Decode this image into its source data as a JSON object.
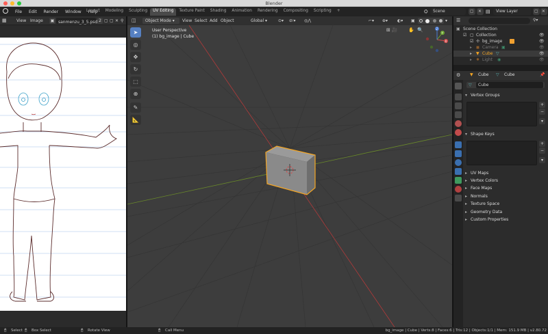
{
  "window": {
    "title": "Blender",
    "traffic_colors": [
      "#fd5f57",
      "#febc2e",
      "#28c840"
    ]
  },
  "topbar": {
    "menus": [
      "File",
      "Edit",
      "Render",
      "Window",
      "Help"
    ],
    "workspaces": [
      "Layout",
      "Modeling",
      "Sculpting",
      "UV Editing",
      "Texture Paint",
      "Shading",
      "Animation",
      "Rendering",
      "Compositing",
      "Scripting"
    ],
    "active_workspace": "UV Editing",
    "add_tab": "+",
    "scene": "Scene",
    "view_layer": "View Layer"
  },
  "image_editor": {
    "menus": [
      "View",
      "Image"
    ],
    "image_name": "sanmenzu_3_5.psd",
    "users": "2"
  },
  "viewport": {
    "mode": "Object Mode",
    "menus": [
      "View",
      "Select",
      "Add",
      "Object"
    ],
    "orientation": "Global",
    "info_line1": "User Perspective",
    "info_line2": "(1) bg_image | Cube",
    "gizmo": {
      "x": "X",
      "y": "Y",
      "z": "Z"
    },
    "colors": {
      "cube_outline": "#f5a623",
      "x_axis": "#b33a3a",
      "y_axis": "#6a8a2a"
    }
  },
  "outliner": {
    "title": "Scene Collection",
    "items": [
      {
        "label": "Collection"
      },
      {
        "label": "bg_image"
      },
      {
        "label": "Camera"
      },
      {
        "label": "Cube"
      },
      {
        "label": "Light"
      }
    ]
  },
  "properties": {
    "breadcrumb_obj": "Cube",
    "breadcrumb_data": "Cube",
    "data_name": "Cube",
    "panels": {
      "vertex_groups": "Vertex Groups",
      "shape_keys": "Shape Keys",
      "uv_maps": "UV Maps",
      "vertex_colors": "Vertex Colors",
      "face_maps": "Face Maps",
      "normals": "Normals",
      "texture_space": "Texture Space",
      "geometry_data": "Geometry Data",
      "custom_properties": "Custom Properties"
    },
    "plus": "+",
    "minus": "−"
  },
  "statusbar": {
    "select": "Select",
    "box_select": "Box Select",
    "rotate_view": "Rotate View",
    "call_menu": "Call Menu",
    "stats": "bg_image | Cube | Verts:8 | Faces:6 | Tris:12 | Objects:1/1 | Mem: 151.9 MB | v2.80.72"
  }
}
